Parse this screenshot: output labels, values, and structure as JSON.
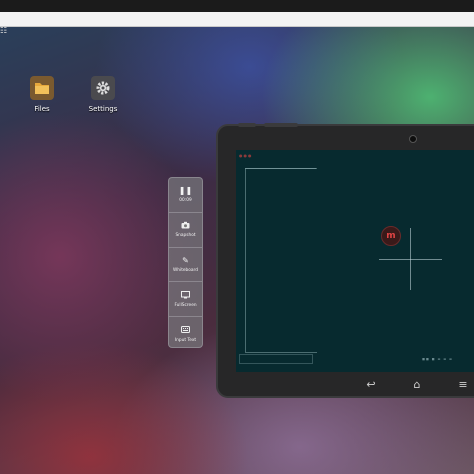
{
  "desktop": {
    "apps": [
      {
        "label": "Files",
        "icon": "folder-icon",
        "tile_color": "#7a5a2f"
      },
      {
        "label": "Settings",
        "icon": "gear-icon",
        "tile_color": "#4a4a4e"
      }
    ]
  },
  "toolbar": {
    "items": [
      {
        "icon": "pause-icon",
        "label": "00:09"
      },
      {
        "icon": "camera-icon",
        "label": "Snapshot"
      },
      {
        "icon": "pencil-icon",
        "label": "Whiteboard"
      },
      {
        "icon": "monitor-icon",
        "label": "FullScreen"
      },
      {
        "icon": "keyboard-icon",
        "label": "Input Text"
      }
    ]
  },
  "tablet": {
    "nav_buttons": [
      {
        "icon": "back-icon",
        "glyph": "↩"
      },
      {
        "icon": "home-icon",
        "glyph": "⌂"
      },
      {
        "icon": "menu-icon",
        "glyph": "≡"
      }
    ],
    "screen_color": "#072a2f"
  }
}
